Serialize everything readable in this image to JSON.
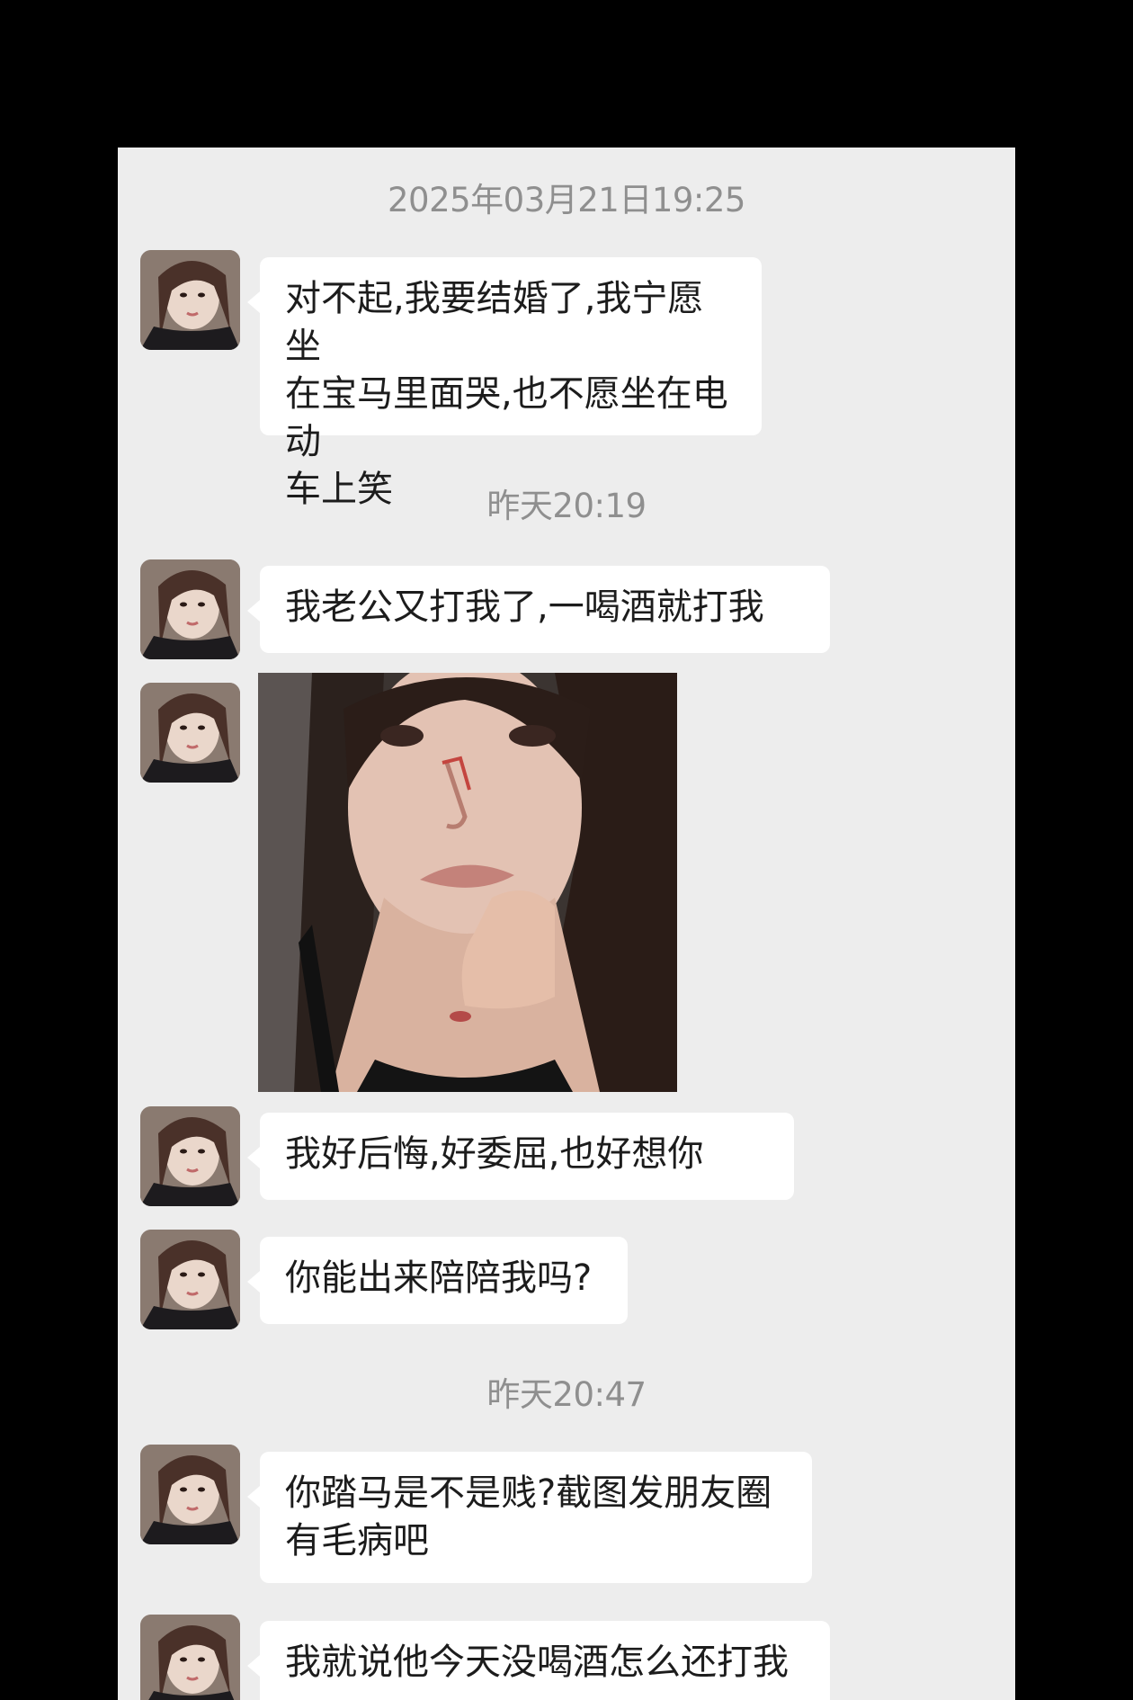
{
  "timestamps": {
    "t1": "2025年03月21日19:25",
    "t2": "昨天20:19",
    "t3": "昨天20:47"
  },
  "messages": {
    "m1": "对不起,我要结婚了,我宁愿坐\n在宝马里面哭,也不愿坐在电动\n车上笑",
    "m2": "我老公又打我了,一喝酒就打我",
    "m3": "我好后悔,好委屈,也好想你",
    "m4": "你能出来陪陪我吗?",
    "m5": "你踏马是不是贱?截图发朋友圈\n有毛病吧",
    "m6": "我就说他今天没喝酒怎么还打我"
  },
  "icons": {
    "avatar": "contact-avatar-photo",
    "image": "selfie-photo-message"
  }
}
